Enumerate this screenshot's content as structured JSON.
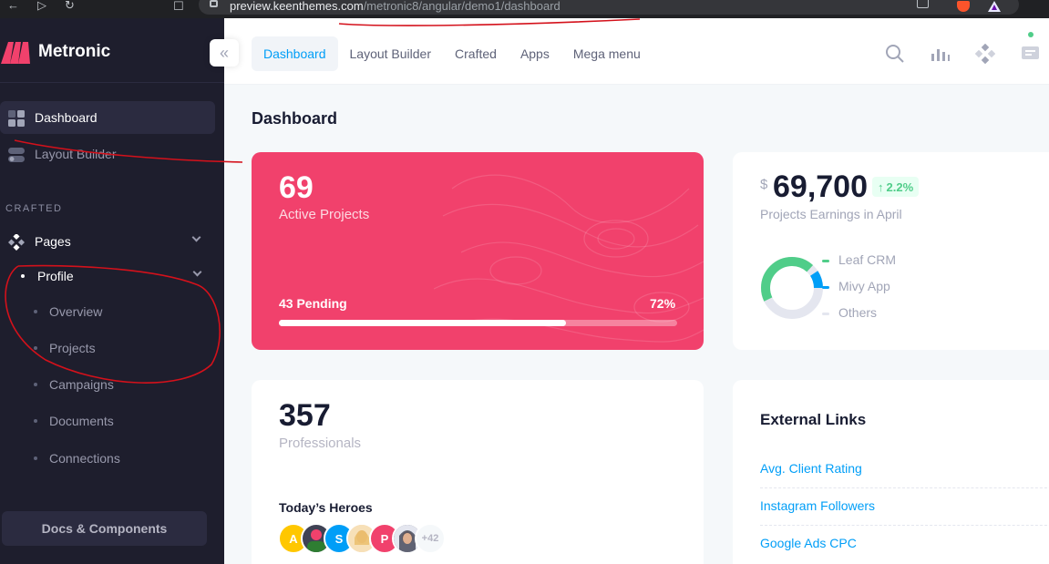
{
  "browser": {
    "url_host": "preview.keenthemes.com",
    "url_path": "/metronic8/angular/demo1/dashboard"
  },
  "sidebar": {
    "brand": "Metronic",
    "items": [
      {
        "label": "Dashboard",
        "icon": "dashboard-grid-icon",
        "active": true
      },
      {
        "label": "Layout Builder",
        "icon": "toggle-icon",
        "active": false
      }
    ],
    "section_label": "CRAFTED",
    "pages": {
      "label": "Pages",
      "icon": "pages-diamond-icon"
    },
    "profile": {
      "label": "Profile",
      "children": [
        "Overview",
        "Projects",
        "Campaigns",
        "Documents",
        "Connections"
      ]
    },
    "docs_button": "Docs & Components"
  },
  "header": {
    "collapse_icon": "double-chevron-left-icon",
    "menu": [
      {
        "label": "Dashboard",
        "active": true
      },
      {
        "label": "Layout Builder",
        "active": false
      },
      {
        "label": "Crafted",
        "active": false
      },
      {
        "label": "Apps",
        "active": false
      },
      {
        "label": "Mega menu",
        "active": false
      }
    ],
    "icons": [
      "search-icon",
      "chart-icon",
      "apps-icon",
      "chat-icon"
    ]
  },
  "page": {
    "title": "Dashboard"
  },
  "projects_card": {
    "count": "69",
    "label": "Active Projects",
    "pending": "43 Pending",
    "percent_label": "72%",
    "progress": 0.72,
    "color": "#f1416c"
  },
  "earnings_card": {
    "currency": "$",
    "amount": "69,700",
    "change": "2.2%",
    "label": "Projects Earnings in April",
    "legend": [
      {
        "label": "Leaf CRM",
        "color": "#50cd89"
      },
      {
        "label": "Mivy App",
        "color": "#009ef7"
      },
      {
        "label": "Others",
        "color": "#e4e6ef"
      }
    ]
  },
  "professionals_card": {
    "count": "357",
    "label": "Professionals",
    "heroes_label": "Today’s Heroes",
    "avatars": [
      {
        "initial": "A",
        "color": "#ffc700"
      },
      {
        "initial": "",
        "color": "#3f4254"
      },
      {
        "initial": "S",
        "color": "#009ef7"
      },
      {
        "initial": "",
        "color": "#f4d3a8"
      },
      {
        "initial": "P",
        "color": "#f1416c"
      },
      {
        "initial": "",
        "color": "#5e6278"
      },
      {
        "initial": "+42",
        "color": "#f5f8fa"
      }
    ]
  },
  "external_links": {
    "title": "External Links",
    "links": [
      "Avg. Client Rating",
      "Instagram Followers",
      "Google Ads CPC"
    ]
  }
}
